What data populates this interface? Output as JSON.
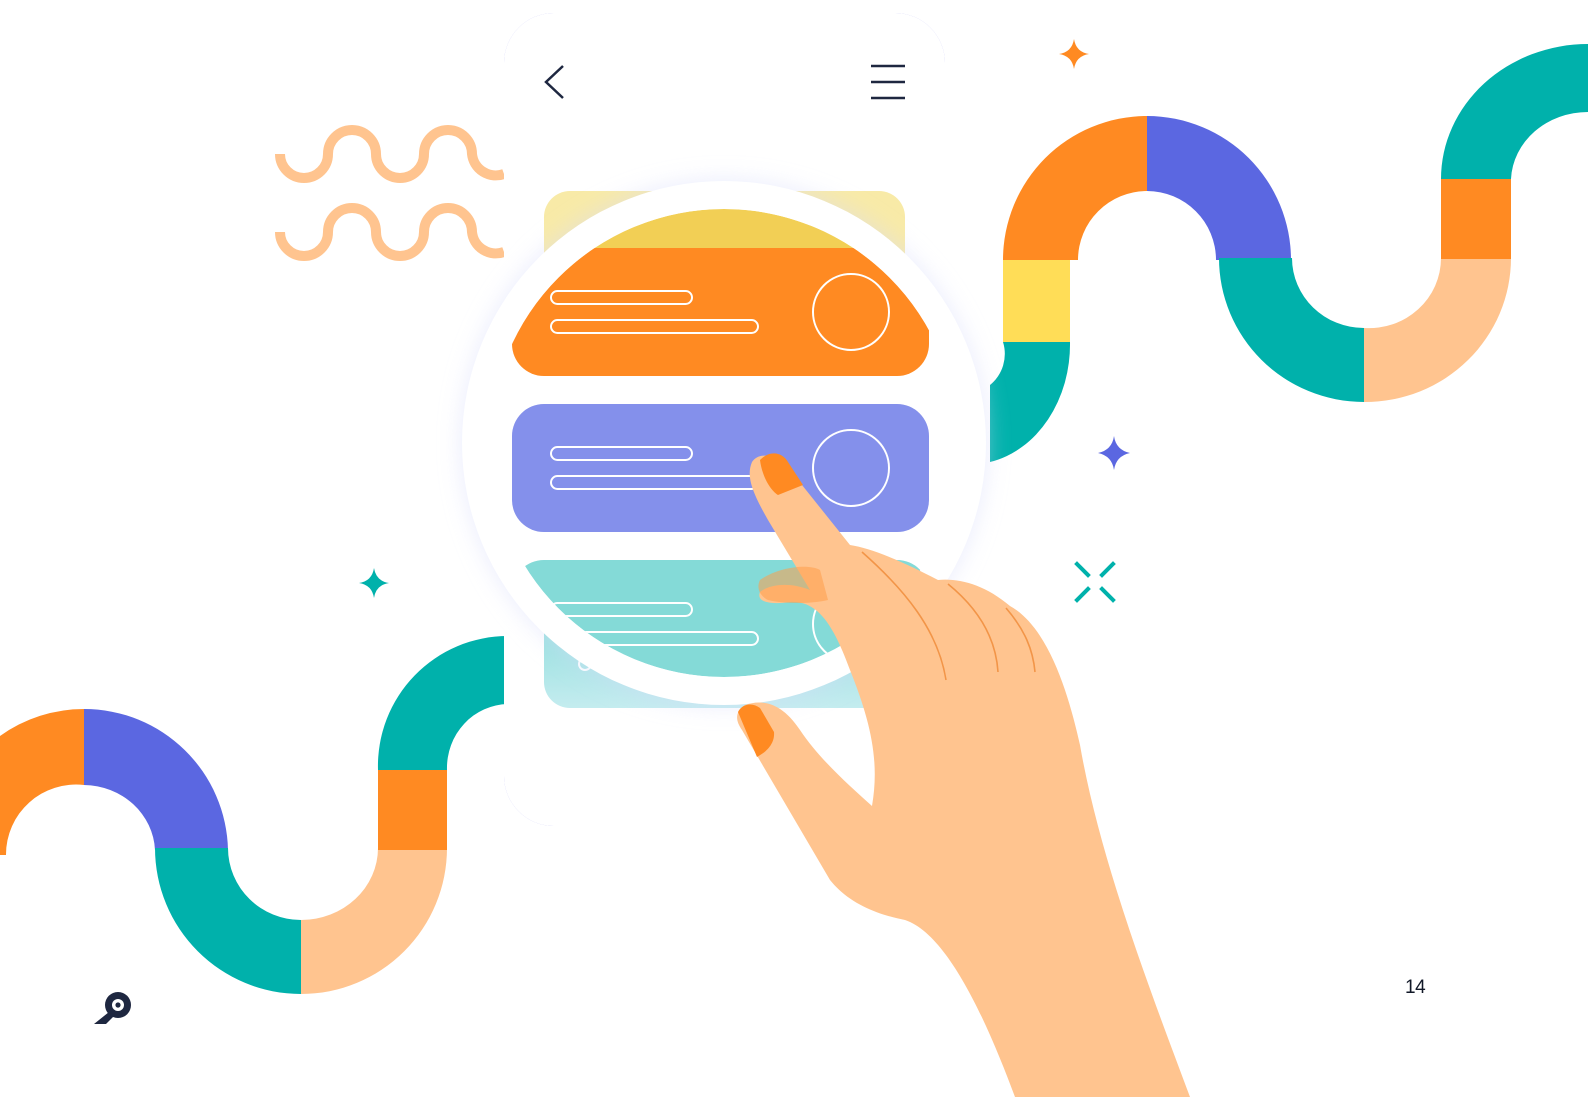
{
  "page": {
    "number": "14"
  },
  "colors": {
    "orange": "#FF8A22",
    "indigo": "#5B67E1",
    "teal": "#00B1AB",
    "peach": "#FFC48F",
    "yellow": "#FFDD57",
    "navy": "#1E2740",
    "card_orange": "#FF8A22",
    "card_purple": "#8490EB",
    "card_teal": "#84DAD7",
    "skin": "#FFC48F",
    "nail": "#FF8A22"
  },
  "phone": {
    "back_icon": "chevron-left-icon",
    "menu_icon": "hamburger-menu-icon",
    "cards": [
      {
        "color": "orange",
        "icon": "circle-outline-icon"
      },
      {
        "color": "purple",
        "icon": "circle-outline-icon"
      },
      {
        "color": "teal",
        "icon": "circle-outline-icon"
      }
    ]
  },
  "decorations": {
    "sparkles": [
      "orange-sparkle-icon",
      "indigo-sparkle-icon",
      "teal-sparkle-icon",
      "teal-cross-sparkle-icon"
    ],
    "squiggles": [
      "peach-wave-icon",
      "peach-wave-icon"
    ]
  },
  "logo": {
    "icon": "magnifier-logo-icon"
  }
}
